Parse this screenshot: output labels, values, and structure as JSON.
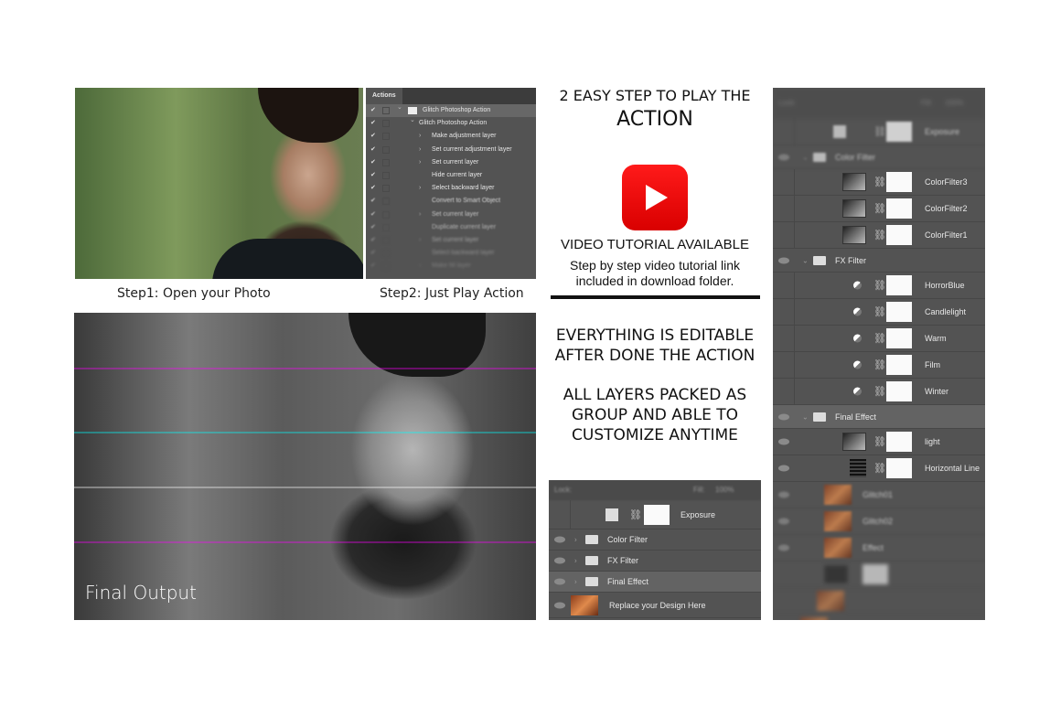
{
  "step1": {
    "caption": "Step1: Open your Photo"
  },
  "step2": {
    "caption": "Step2: Just Play Action"
  },
  "actions_panel": {
    "tab": "Actions",
    "items": [
      {
        "label": "Glitch Photoshop Action",
        "level": 0,
        "selected": true
      },
      {
        "label": "Glitch Photoshop Action",
        "level": 1
      },
      {
        "label": "Make adjustment layer",
        "level": 2,
        "expand": true
      },
      {
        "label": "Set current adjustment layer",
        "level": 2,
        "expand": true
      },
      {
        "label": "Set current layer",
        "level": 2,
        "expand": true
      },
      {
        "label": "Hide current layer",
        "level": 2
      },
      {
        "label": "Select backward layer",
        "level": 2,
        "expand": true
      },
      {
        "label": "Convert to Smart Object",
        "level": 2
      },
      {
        "label": "Set current layer",
        "level": 2,
        "expand": true
      },
      {
        "label": "Duplicate current layer",
        "level": 2
      },
      {
        "label": "Set current layer",
        "level": 2,
        "expand": true
      },
      {
        "label": "Select backward layer",
        "level": 2
      },
      {
        "label": "Make fill layer",
        "level": 2,
        "expand": true
      }
    ]
  },
  "final_output": {
    "caption": "Final Output"
  },
  "promo": {
    "headline_line1": "2 EASY STEP TO PLAY THE",
    "headline_line2": "ACTION",
    "play_icon": "youtube-play-icon",
    "youtube_color": "#ff0000",
    "video_title": "VIDEO TUTORIAL AVAILABLE",
    "video_desc_line1": "Step by step video tutorial link",
    "video_desc_line2": "included in download folder.",
    "editable_line1": "EVERYTHING IS EDITABLE",
    "editable_line2": "AFTER DONE THE ACTION",
    "layers_line1": "ALL LAYERS PACKED AS",
    "layers_line2": "GROUP AND ABLE TO",
    "layers_line3": "CUSTOMIZE ANYTIME"
  },
  "small_layers": {
    "lock_label": "Lock:",
    "fill_label": "Fill:",
    "fill_value": "100%",
    "rows": [
      {
        "name": "Exposure",
        "type": "adjustment"
      },
      {
        "name": "Color Filter",
        "type": "group"
      },
      {
        "name": "FX Filter",
        "type": "group"
      },
      {
        "name": "Final Effect",
        "type": "group",
        "selected": true
      },
      {
        "name": "Replace your Design Here",
        "type": "smart"
      }
    ]
  },
  "right_layers": {
    "lock_label": "Lock:",
    "fill_label": "Fill:",
    "fill_value": "100%",
    "rows": [
      {
        "name": "Exposure",
        "type": "adjustment",
        "blur": true
      },
      {
        "name": "Color Filter",
        "type": "group",
        "blur": true
      },
      {
        "name": "ColorFilter3",
        "type": "gradient"
      },
      {
        "name": "ColorFilter2",
        "type": "gradient"
      },
      {
        "name": "ColorFilter1",
        "type": "gradient"
      },
      {
        "name": "FX Filter",
        "type": "group"
      },
      {
        "name": "HorrorBlue",
        "type": "adj"
      },
      {
        "name": "Candlelight",
        "type": "adj"
      },
      {
        "name": "Warm",
        "type": "adj"
      },
      {
        "name": "Film",
        "type": "adj"
      },
      {
        "name": "Winter",
        "type": "adj"
      },
      {
        "name": "Final Effect",
        "type": "group",
        "selected": true
      },
      {
        "name": "light",
        "type": "gradient"
      },
      {
        "name": "Horizontal Line",
        "type": "pattern"
      },
      {
        "name": "Glitch01",
        "type": "smart",
        "blur": true
      },
      {
        "name": "Glitch02",
        "type": "smart",
        "blur": true
      },
      {
        "name": "Effect",
        "type": "smart",
        "blur": true
      }
    ]
  }
}
